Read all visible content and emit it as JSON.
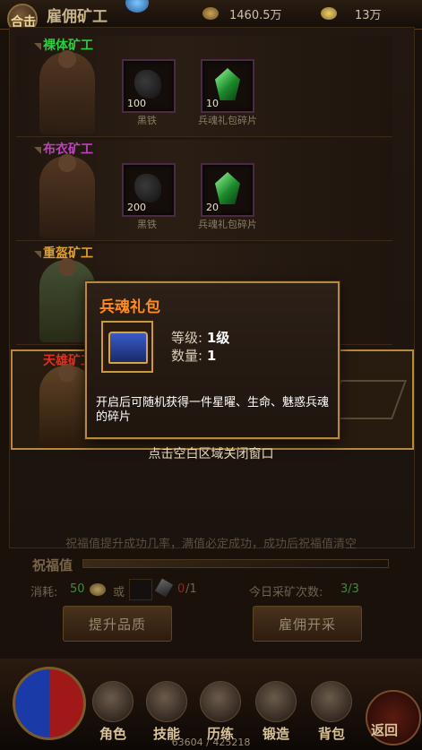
{
  "top_bar": {
    "hit_label": "合击",
    "page_title": "雇佣矿工",
    "gold_amount": "1460.5万",
    "ingot_amount": "13万"
  },
  "miners": [
    {
      "name": "裸体矿工",
      "name_color": "#2ecc40",
      "items": [
        {
          "count": "100",
          "label": "黑铁",
          "icon": "black-iron-icon"
        },
        {
          "count": "10",
          "label": "兵魂礼包碎片",
          "icon": "green-gem-icon"
        }
      ]
    },
    {
      "name": "布衣矿工",
      "name_color": "#c040c0",
      "items": [
        {
          "count": "200",
          "label": "黑铁",
          "icon": "black-iron-icon"
        },
        {
          "count": "20",
          "label": "兵魂礼包碎片",
          "icon": "green-gem-icon"
        }
      ]
    },
    {
      "name": "重盔矿工",
      "name_color": "#e0a030",
      "items": []
    },
    {
      "name": "天雄矿工",
      "name_color": "#e03020",
      "items": []
    }
  ],
  "blessing": {
    "hint": "祝福值提升成功几率，满值必定成功，成功后祝福值清空",
    "label": "祝福值",
    "cost_label": "消耗:",
    "cost_amount": "50",
    "or_label": "或",
    "item_count": "0",
    "item_need": "/1",
    "daily_label": "今日采矿次数:",
    "daily_value": "3/3"
  },
  "buttons": {
    "upgrade": "提升品质",
    "hire": "雇佣开采"
  },
  "bottom_nav": [
    {
      "label": "角色",
      "icon": "character-icon"
    },
    {
      "label": "技能",
      "icon": "skill-icon"
    },
    {
      "label": "历练",
      "icon": "training-icon"
    },
    {
      "label": "锻造",
      "icon": "forge-icon"
    },
    {
      "label": "背包",
      "icon": "bag-icon"
    }
  ],
  "return_label": "返回",
  "exp_text": "63604 / 425218",
  "popup": {
    "title": "兵魂礼包",
    "level_key": "等级:",
    "level_value": "1级",
    "qty_key": "数量:",
    "qty_value": "1",
    "description": "开启后可随机获得一件星曜、生命、魅惑兵魂的碎片"
  },
  "close_hint": "点击空白区域关闭窗口"
}
